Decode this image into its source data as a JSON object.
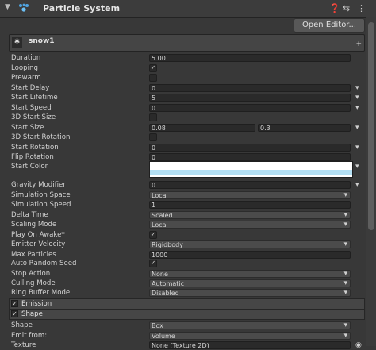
{
  "header": {
    "title": "Particle System"
  },
  "open_editor_label": "Open Editor...",
  "module": {
    "name": "snow1",
    "plus": "+"
  },
  "rows": [
    {
      "label": "Duration",
      "value": "5.00"
    },
    {
      "label": "Looping",
      "value": "✓"
    },
    {
      "label": "Prewarm",
      "value": ""
    },
    {
      "label": "Start Delay",
      "value": "0"
    },
    {
      "label": "Start Lifetime",
      "value": "5"
    },
    {
      "label": "Start Speed",
      "value": "0"
    },
    {
      "label": "3D Start Size",
      "value": ""
    },
    {
      "label": "Start Size",
      "value": "0.08",
      "value2": "0.3"
    },
    {
      "label": "3D Start Rotation",
      "value": ""
    },
    {
      "label": "Start Rotation",
      "value": "0"
    },
    {
      "label": "Flip Rotation",
      "value": "0"
    },
    {
      "label": "Start Color"
    },
    {
      "label": "Gravity Modifier",
      "value": "0"
    },
    {
      "label": "Simulation Space",
      "value": "Local"
    },
    {
      "label": "Simulation Speed",
      "value": "1"
    },
    {
      "label": "Delta Time",
      "value": "Scaled"
    },
    {
      "label": "Scaling Mode",
      "value": "Local"
    },
    {
      "label": "Play On Awake*",
      "value": "✓"
    },
    {
      "label": "Emitter Velocity",
      "value": "Rigidbody"
    },
    {
      "label": "Max Particles",
      "value": "1000"
    },
    {
      "label": "Auto Random Seed",
      "value": "✓"
    },
    {
      "label": "Stop Action",
      "value": "None"
    },
    {
      "label": "Culling Mode",
      "value": "Automatic"
    },
    {
      "label": "Ring Buffer Mode",
      "value": "Disabled"
    }
  ],
  "sections": [
    {
      "label": "Emission",
      "check": "✓"
    },
    {
      "label": "Shape",
      "check": "✓"
    }
  ],
  "shape_rows": [
    {
      "label": "Shape",
      "value": "Box"
    },
    {
      "label": "Emit from:",
      "value": "Volume"
    },
    {
      "label": "Texture",
      "value": "None (Texture 2D)"
    }
  ],
  "colors": {
    "start_color_top": "#ffffff",
    "start_color_band": "#b3dff3"
  }
}
